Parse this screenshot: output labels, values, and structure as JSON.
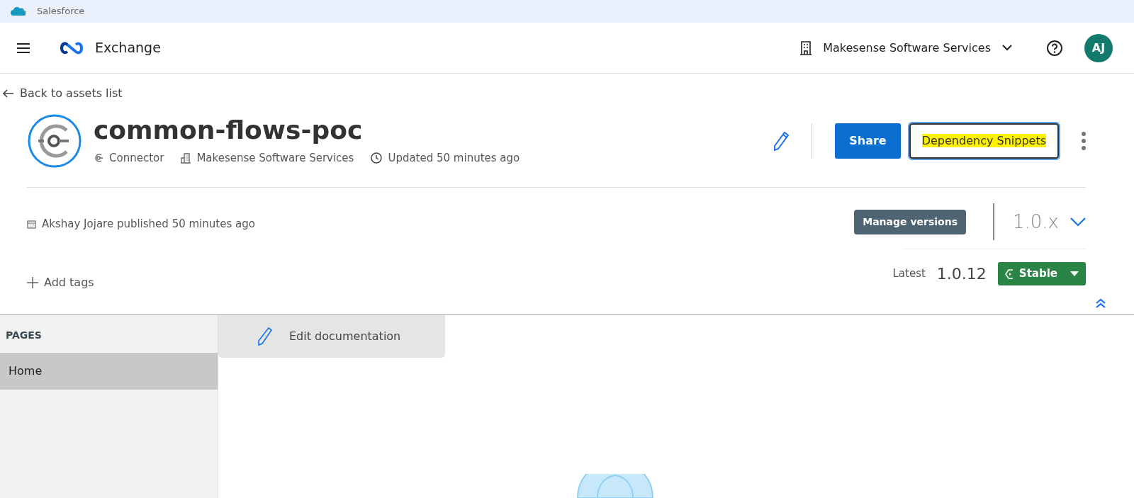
{
  "browser_bar": {
    "title": "Salesforce"
  },
  "header": {
    "app_name": "Exchange",
    "organization": "Makesense Software Services",
    "avatar_initials": "AJ"
  },
  "back_link": "Back to assets list",
  "asset": {
    "name": "common-flows-poc",
    "type": "Connector",
    "organization": "Makesense Software Services",
    "updated": "Updated 50 minutes ago"
  },
  "actions": [
    {
      "kind": "primary",
      "label": "Share",
      "highlighted": false
    },
    {
      "kind": "outline",
      "label": "Dependency Snippets",
      "highlighted": true
    }
  ],
  "published": "Akshay Jojare published 50 minutes ago",
  "versions": {
    "manage_label": "Manage versions",
    "current": "1.0.x",
    "latest_label": "Latest",
    "latest": "1.0.12",
    "stability": "Stable"
  },
  "add_tags": "Add tags",
  "sidebar": {
    "heading": "PAGES",
    "items": [
      {
        "label": "Home",
        "selected": true
      }
    ]
  },
  "edit_documentation": "Edit documentation"
}
